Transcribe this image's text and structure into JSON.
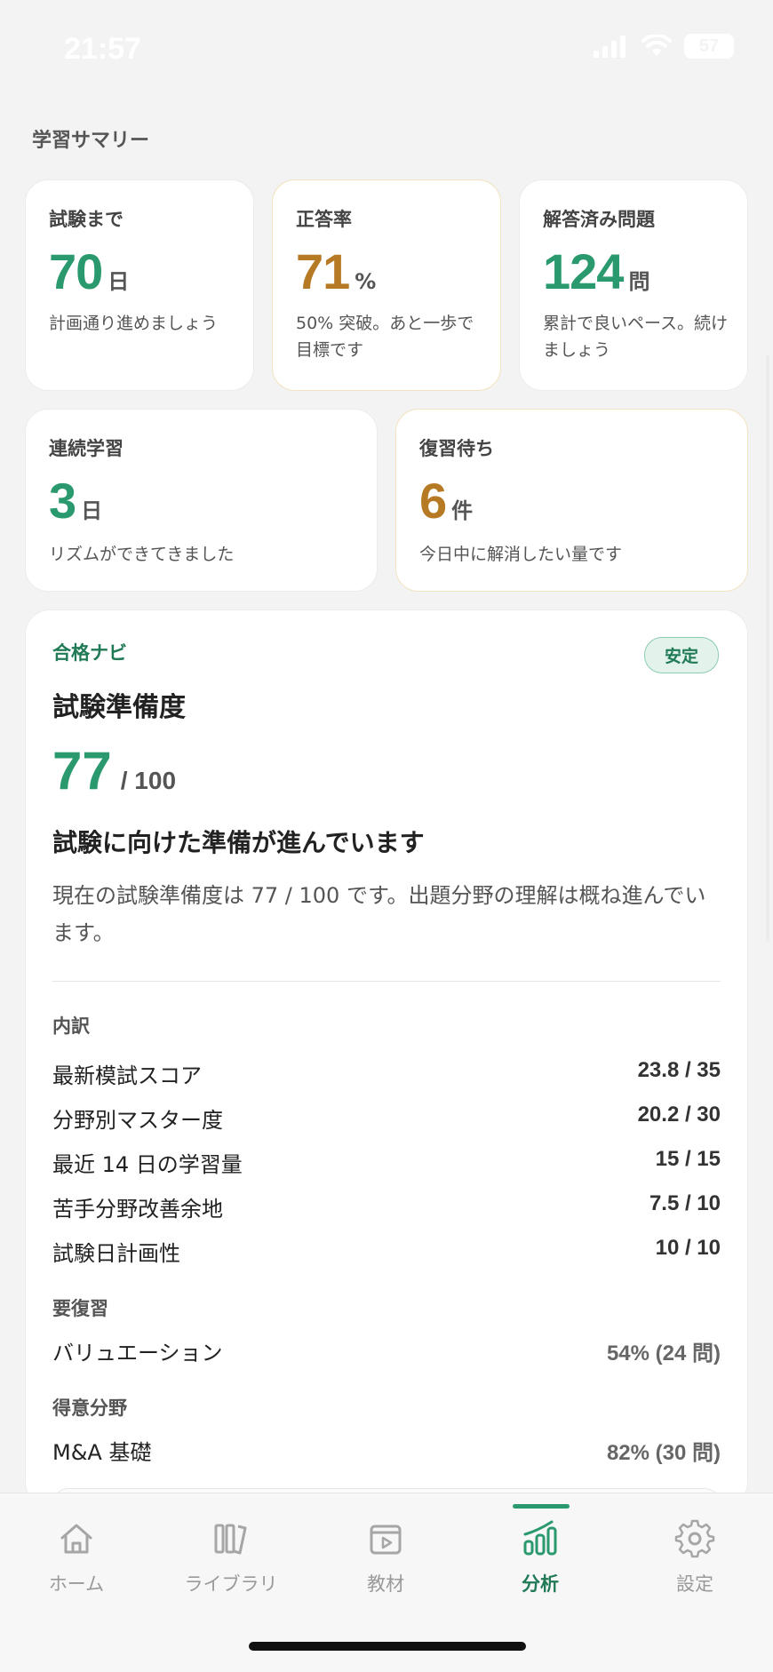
{
  "status": {
    "time": "21:57",
    "battery": "57"
  },
  "summary": {
    "section_title": "学習サマリー",
    "cards": [
      {
        "label": "試験まで",
        "value": "70",
        "unit": "日",
        "desc": "計画通り進めましょう"
      },
      {
        "label": "正答率",
        "value": "71",
        "unit": "%",
        "desc": "50% 突破。あと一歩で目標です"
      },
      {
        "label": "解答済み問題",
        "value": "124",
        "unit": "問",
        "desc": "累計で良いペース。続けましょう"
      },
      {
        "label": "連続学習",
        "value": "3",
        "unit": "日",
        "desc": "リズムができてきました"
      },
      {
        "label": "復習待ち",
        "value": "6",
        "unit": "件",
        "desc": "今日中に解消したい量です"
      }
    ]
  },
  "navi": {
    "header": "合格ナビ",
    "badge": "安定",
    "title": "試験準備度",
    "score": "77",
    "score_max": "/ 100",
    "readiness": 0.77,
    "headline": "試験に向けた準備が進んでいます",
    "paragraph": "現在の試験準備度は 77 / 100 です。出題分野の理解は概ね進んでいます。",
    "breakdown_label": "内訳",
    "breakdown": [
      {
        "name": "最新模試スコア",
        "value": "23.8 / 35"
      },
      {
        "name": "分野別マスター度",
        "value": "20.2 / 30"
      },
      {
        "name": "最近 14 日の学習量",
        "value": "15 / 15"
      },
      {
        "name": "苦手分野改善余地",
        "value": "7.5 / 10"
      },
      {
        "name": "試験日計画性",
        "value": "10 / 10"
      }
    ],
    "review_label": "要復習",
    "review": {
      "name": "バリュエーション",
      "value": "54% (24 問)"
    },
    "strength_label": "得意分野",
    "strength": {
      "name": "M&A 基礎",
      "value": "82% (30 問)"
    }
  },
  "tabs": [
    {
      "label": "ホーム",
      "icon": "home-icon"
    },
    {
      "label": "ライブラリ",
      "icon": "library-icon"
    },
    {
      "label": "教材",
      "icon": "video-icon"
    },
    {
      "label": "分析",
      "icon": "chart-icon",
      "active": true
    },
    {
      "label": "設定",
      "icon": "gear-icon"
    }
  ],
  "colors": {
    "accent": "#2a9a6e",
    "warn": "#b67a25",
    "background": "#f2f3f2"
  }
}
